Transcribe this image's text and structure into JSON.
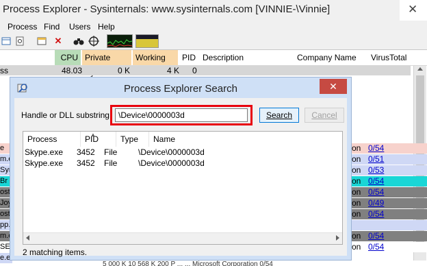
{
  "window": {
    "title": "Process Explorer - Sysinternals: www.sysinternals.com [VINNIE-\\Vinnie]",
    "close_glyph": "✕"
  },
  "menu": [
    "Process",
    "Find",
    "Users",
    "Help"
  ],
  "columns": {
    "cpu": "CPU",
    "private_bytes": "Private Bytes",
    "working_set": "Working Set",
    "pid": "PID",
    "description": "Description",
    "company_name": "Company Name",
    "virustotal": "VirusTotal"
  },
  "first_row": {
    "name_fragment": "ss",
    "cpu": "48.03",
    "private_bytes": "0 K",
    "working_set": "4 K",
    "pid": "0"
  },
  "left_fragments": [
    "e",
    "m.e",
    "Syn",
    "Br",
    "ost",
    "Joy",
    "ost",
    "pp.",
    "m.e",
    "SE",
    "e.e"
  ],
  "right_rows": [
    {
      "on": "on",
      "vt": "0/54"
    },
    {
      "on": "on",
      "vt": "0/51"
    },
    {
      "on": "on",
      "vt": "0/53"
    },
    {
      "on": "on",
      "vt": "0/54"
    },
    {
      "on": "on",
      "vt": "0/54"
    },
    {
      "on": "on",
      "vt": "0/49"
    },
    {
      "on": "on",
      "vt": "0/54"
    },
    {
      "on": "",
      "vt": ""
    },
    {
      "on": "on",
      "vt": "0/54"
    },
    {
      "on": "on",
      "vt": "0/54"
    }
  ],
  "bottom_row_fragment": "5 000 K    10 568 K    200 P    ...    ...    Microsoft Corporation    0/54",
  "dialog": {
    "title": "Process Explorer Search",
    "close_glyph": "✕",
    "label": "Handle or DLL substring:",
    "search_value": "\\Device\\0000003d",
    "search_button": "Search",
    "cancel_button": "Cancel",
    "result_headers": {
      "process": "Process",
      "pid": "PID",
      "type": "Type",
      "name": "Name"
    },
    "results": [
      {
        "process": "Skype.exe",
        "pid": "3452",
        "type": "File",
        "name": "\\Device\\0000003d"
      },
      {
        "process": "Skype.exe",
        "pid": "3452",
        "type": "File",
        "name": "\\Device\\0000003d"
      }
    ],
    "status": "2 matching items."
  },
  "colors": {
    "cpu_header": "#b8dcb8",
    "private_header": "#f9d8a8",
    "working_header": "#f9d8a8",
    "highlight": "#e8000d"
  }
}
